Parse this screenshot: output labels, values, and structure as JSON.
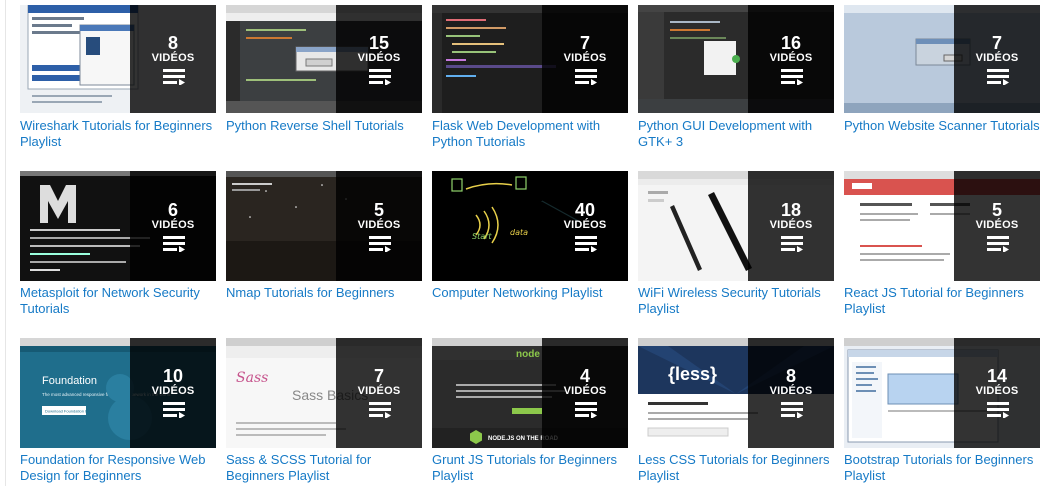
{
  "videos_label": "VIDÉOS",
  "colors": {
    "link": "#167ac6",
    "overlay": "rgba(0,0,0,0.80)"
  },
  "playlists": [
    {
      "title": "Wireshark Tutorials for Beginners Playlist",
      "count": "8",
      "thumb": "windows-dialog"
    },
    {
      "title": "Python Reverse Shell Tutorials",
      "count": "15",
      "thumb": "ide-dialog"
    },
    {
      "title": "Flask Web Development with Python Tutorials",
      "count": "7",
      "thumb": "dark-code-editor"
    },
    {
      "title": "Python GUI Development with GTK+ 3",
      "count": "16",
      "thumb": "ide-popup"
    },
    {
      "title": "Python Website Scanner Tutorials",
      "count": "7",
      "thumb": "desktop-dialog"
    },
    {
      "title": "Metasploit for Network Security Tutorials",
      "count": "6",
      "thumb": "terminal-logo"
    },
    {
      "title": "Nmap Tutorials for Beginners",
      "count": "5",
      "thumb": "night-sky"
    },
    {
      "title": "Computer Networking Playlist",
      "count": "40",
      "thumb": "chalkboard"
    },
    {
      "title": "WiFi Wireless Security Tutorials Playlist",
      "count": "18",
      "thumb": "wifi-antennas"
    },
    {
      "title": "React JS Tutorial for Beginners Playlist",
      "count": "5",
      "thumb": "webpage-red"
    },
    {
      "title": "Foundation for Responsive Web Design for Beginners",
      "count": "10",
      "thumb": "foundation-site"
    },
    {
      "title": "Sass & SCSS Tutorial for Beginners Playlist",
      "count": "7",
      "thumb": "sass-site"
    },
    {
      "title": "Grunt JS Tutorials for Beginners Playlist",
      "count": "4",
      "thumb": "node-site"
    },
    {
      "title": "Less CSS Tutorials for Beginners Playlist",
      "count": "8",
      "thumb": "less-site"
    },
    {
      "title": "Bootstrap Tutorials for Beginners Playlist",
      "count": "14",
      "thumb": "file-explorer"
    }
  ],
  "thumb_text": {
    "foundation": "Foundation",
    "foundation_tagline": "The most advanced responsive front-end framework in the world.",
    "foundation_button": "Download Foundation 6",
    "sass_logo": "Sass",
    "sass_heading": "Sass Basics",
    "node_logo": "node",
    "node_banner": "NODE.JS ON THE ROAD",
    "less_logo": "{less}",
    "chalk_word_1": "Start",
    "chalk_word_2": "data"
  }
}
